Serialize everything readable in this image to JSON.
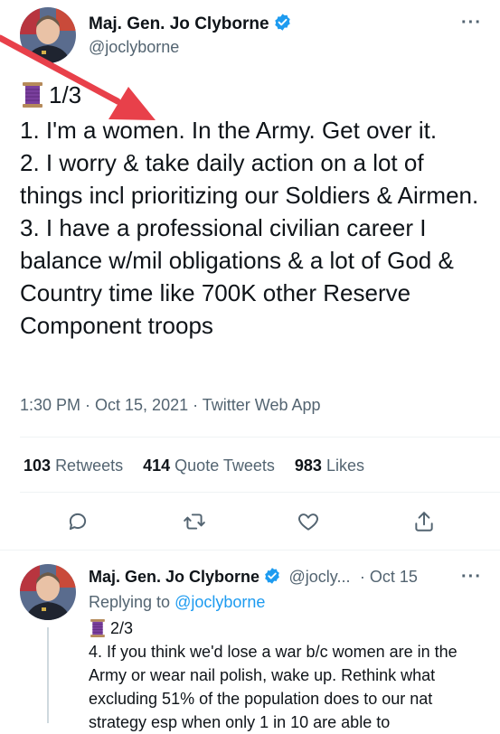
{
  "main_tweet": {
    "display_name": "Maj. Gen. Jo Clyborne",
    "handle": "@joclyborne",
    "thread_count": "1/3",
    "lines": [
      "1.  I'm a women. In the Army. Get over it.",
      "2.  I worry & take daily action on a lot of things incl prioritizing our Soldiers & Airmen.",
      "3. I have a professional civilian career I balance w/mil obligations & a lot of God & Country time like 700K other Reserve Component troops"
    ],
    "timestamp": "1:30 PM · Oct 15, 2021 · Twitter Web App",
    "retweets_count": "103",
    "retweets_label": "Retweets",
    "quotes_count": "414",
    "quotes_label": "Quote Tweets",
    "likes_count": "983",
    "likes_label": "Likes"
  },
  "reply_tweet": {
    "display_name": "Maj. Gen. Jo Clyborne",
    "handle": "@jocly...",
    "date": "· Oct 15",
    "replying_prefix": "Replying to",
    "replying_to": "@joclyborne",
    "thread_count": "2/3",
    "text": "4. If you think we'd lose a war b/c women are in the Army or wear nail polish, wake up. Rethink what excluding 51% of the population does to our nat strategy esp when only 1 in 10 are able to"
  },
  "colors": {
    "accent": "#1d9bf0",
    "annotation_arrow": "#e8404a",
    "secondary_text": "#536471"
  }
}
